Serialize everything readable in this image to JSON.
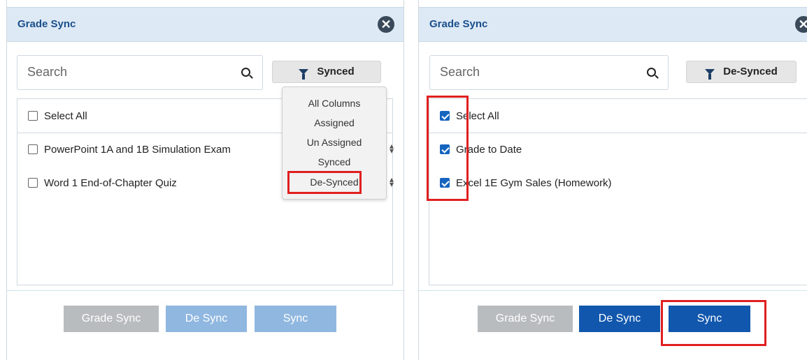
{
  "left_panel": {
    "title": "Grade Sync",
    "close_icon": "close-circle-icon",
    "search": {
      "placeholder": "Search"
    },
    "filter": {
      "label": "Synced",
      "icon": "funnel-icon"
    },
    "select_all": "Select All",
    "items": [
      {
        "label": "PowerPoint 1A and 1B Simulation Exam",
        "checked": false
      },
      {
        "label": "Word 1 End-of-Chapter Quiz",
        "checked": false
      }
    ],
    "dropdown": {
      "options": [
        "All Columns",
        "Assigned",
        "Un Assigned",
        "Synced",
        "De-Synced"
      ],
      "highlighted": "De-Synced"
    },
    "buttons": {
      "grade_sync": "Grade Sync",
      "de_sync": "De Sync",
      "sync": "Sync"
    }
  },
  "right_panel": {
    "title": "Grade Sync",
    "close_icon": "close-circle-icon",
    "search": {
      "placeholder": "Search"
    },
    "filter": {
      "label": "De-Synced",
      "icon": "funnel-icon"
    },
    "select_all": "Select All",
    "items": [
      {
        "label": "Grade to Date",
        "checked": true
      },
      {
        "label": "Excel 1E Gym Sales (Homework)",
        "checked": true
      }
    ],
    "buttons": {
      "grade_sync": "Grade Sync",
      "de_sync": "De Sync",
      "sync": "Sync"
    }
  },
  "colors": {
    "header_bg": "#ddeaf5",
    "title": "#1a4f8c",
    "primary_button": "#1157ad",
    "disabled_button_light": "#8fb7df",
    "disabled_button_gray": "#b9bcbf",
    "highlight": "#e02020"
  }
}
